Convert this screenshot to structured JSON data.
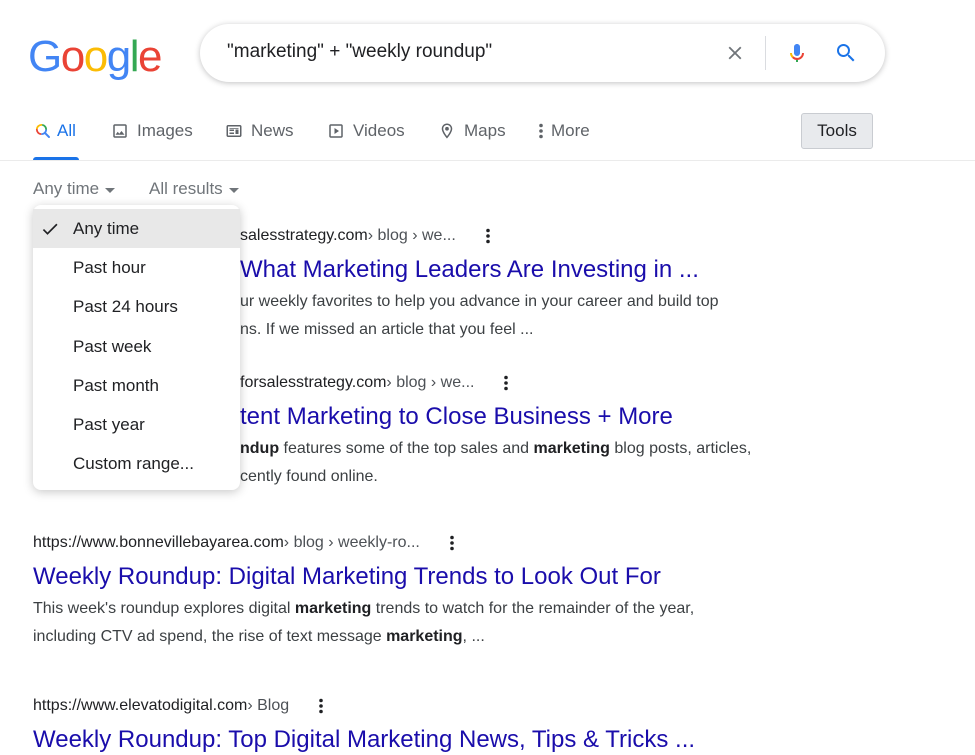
{
  "logo": {
    "letters": [
      "G",
      "o",
      "o",
      "g",
      "l",
      "e"
    ],
    "colors": [
      "#4285F4",
      "#EA4335",
      "#FBBC05",
      "#4285F4",
      "#34A853",
      "#EA4335"
    ]
  },
  "search": {
    "query": "\"marketing\" + \"weekly roundup\""
  },
  "tabs": [
    {
      "label": "All",
      "icon": "search-icon",
      "active": true
    },
    {
      "label": "Images",
      "icon": "image-icon"
    },
    {
      "label": "News",
      "icon": "news-icon"
    },
    {
      "label": "Videos",
      "icon": "video-icon"
    },
    {
      "label": "Maps",
      "icon": "map-pin-icon"
    },
    {
      "label": "More",
      "icon": "more-vertical-icon"
    }
  ],
  "tools_label": "Tools",
  "filters": {
    "time": "Any time",
    "results": "All results"
  },
  "time_menu": {
    "items": [
      "Any time",
      "Past hour",
      "Past 24 hours",
      "Past week",
      "Past month",
      "Past year",
      "Custom range..."
    ],
    "selected": "Any time"
  },
  "results": [
    {
      "url": "salesstrategy.com",
      "crumbs": " › blog › we...",
      "title": "What Marketing Leaders Are Investing in ...",
      "snippet_line1": "ur weekly favorites to help you advance in your career and build top",
      "snippet_line2": "ns. If we missed an article that you feel ..."
    },
    {
      "url": "forsalesstrategy.com",
      "crumbs": " › blog › we...",
      "title": "tent Marketing to Close Business + More",
      "snippet_bold1": "ndup",
      "snippet_a": " features some of the top sales and ",
      "snippet_bold2": "marketing",
      "snippet_b": " blog posts, articles,",
      "snippet_line2": "cently found online."
    },
    {
      "url": "https://www.bonnevillebayarea.com",
      "crumbs": " › blog › weekly-ro...",
      "title": "Weekly Roundup: Digital Marketing Trends to Look Out For",
      "snippet_a": "This week's roundup explores digital ",
      "snippet_bold1": "marketing",
      "snippet_b": " trends to watch for the remainder of the year,",
      "snippet_c": "including CTV ad spend, the rise of text message ",
      "snippet_bold2": "marketing",
      "snippet_d": ", ..."
    },
    {
      "url": "https://www.elevatodigital.com",
      "crumbs": " › Blog",
      "title": "Weekly Roundup: Top Digital Marketing News, Tips & Tricks ..."
    }
  ]
}
